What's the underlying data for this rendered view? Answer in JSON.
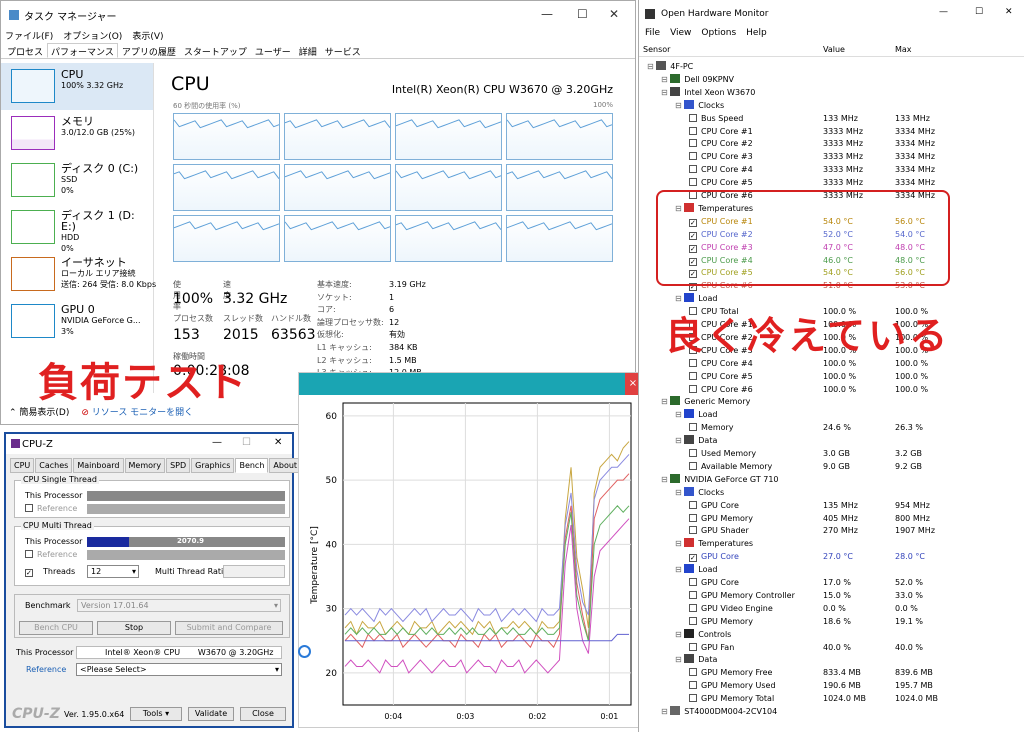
{
  "taskmgr": {
    "title": "タスク マネージャー",
    "menu": [
      "ファイル(F)",
      "オプション(O)",
      "表示(V)"
    ],
    "tabs": [
      "プロセス",
      "パフォーマンス",
      "アプリの履歴",
      "スタートアップ",
      "ユーザー",
      "詳細",
      "サービス"
    ],
    "active_tab": "パフォーマンス",
    "sidebar": [
      {
        "name": "CPU",
        "line1": "100%  3.32 GHz",
        "line2": "",
        "line3": "",
        "color": "#1e88c8"
      },
      {
        "name": "メモリ",
        "line1": "3.0/12.0 GB (25%)",
        "line2": "",
        "line3": "",
        "color": "#9b2dbb"
      },
      {
        "name": "ディスク 0 (C:)",
        "line1": "SSD",
        "line2": "0%",
        "line3": "",
        "color": "#4caf50"
      },
      {
        "name": "ディスク 1 (D: E:)",
        "line1": "HDD",
        "line2": "0%",
        "line3": "",
        "color": "#4caf50"
      },
      {
        "name": "イーサネット",
        "line1": "ローカル エリア接続",
        "line2": "送信: 264 受信: 8.0 Kbps",
        "line3": "",
        "color": "#c86a1e"
      },
      {
        "name": "GPU 0",
        "line1": "NVIDIA GeForce G...",
        "line2": "3%",
        "line3": "",
        "color": "#1e88c8"
      }
    ],
    "header": "CPU",
    "model": "Intel(R) Xeon(R) CPU W3670 @ 3.20GHz",
    "graph_label_left": "60 秒間の使用率 (%)",
    "graph_label_right": "100%",
    "stats": {
      "util_label": "使用率",
      "util": "100%",
      "speed_label": "速度",
      "speed": "3.32 GHz",
      "proc_label": "プロセス数",
      "proc": "153",
      "thr_label": "スレッド数",
      "thr": "2015",
      "handle_label": "ハンドル数",
      "handle": "63563",
      "uptime_label": "稼働時間",
      "uptime": "0:00:28:08"
    },
    "specs": [
      {
        "k": "基本速度:",
        "v": "3.19 GHz"
      },
      {
        "k": "ソケット:",
        "v": "1"
      },
      {
        "k": "コア:",
        "v": "6"
      },
      {
        "k": "論理プロセッサ数:",
        "v": "12"
      },
      {
        "k": "仮想化:",
        "v": "有効"
      },
      {
        "k": "L1 キャッシュ:",
        "v": "384 KB"
      },
      {
        "k": "L2 キャッシュ:",
        "v": "1.5 MB"
      },
      {
        "k": "L3 キャッシュ:",
        "v": "12.0 MB"
      }
    ],
    "footer_simple": "簡易表示(D)",
    "footer_monitor": "リソース モニターを開く"
  },
  "overlay_text": "負荷テスト",
  "note_text": "良く冷えている",
  "cpuz": {
    "title": "CPU-Z",
    "tabs": [
      "CPU",
      "Caches",
      "Mainboard",
      "Memory",
      "SPD",
      "Graphics",
      "Bench",
      "About"
    ],
    "active_tab": "Bench",
    "single_group": "CPU Single Thread",
    "multi_group": "CPU Multi Thread",
    "this_processor": "This Processor",
    "reference": "Reference",
    "multi_score": "2070.9",
    "multi_fraction": 0.21,
    "threads_label": "Threads",
    "threads_value": "12",
    "mt_ratio_label": "Multi Thread Ratio",
    "benchmark_label": "Benchmark",
    "benchmark_value": "Version 17.01.64",
    "bench_cpu_btn": "Bench CPU",
    "stop_btn": "Stop",
    "submit_btn": "Submit and Compare",
    "proc_label": "This Processor",
    "proc_value": "Intel® Xeon® CPU       W3670 @ 3.20GHz",
    "ref_label": "Reference",
    "ref_value": "<Please Select>",
    "brand": "CPU-Z",
    "version": "Ver. 1.95.0.x64",
    "tools_btn": "Tools",
    "validate_btn": "Validate",
    "close_btn": "Close"
  },
  "chart_data": {
    "type": "line",
    "ylabel": "Temperature [°C]",
    "ylim": [
      15,
      62
    ],
    "yticks": [
      20,
      30,
      40,
      50,
      60
    ],
    "xticks": [
      "0:04",
      "0:03",
      "0:02",
      "0:01"
    ],
    "xlim": [
      0,
      1
    ],
    "series": [
      {
        "color": "#c8a640",
        "values": [
          27,
          28,
          26,
          28,
          27,
          27,
          28,
          26,
          27,
          28,
          27,
          26,
          28,
          27,
          27,
          28,
          26,
          27,
          28,
          27,
          28,
          27,
          26,
          28,
          27,
          28,
          26,
          27,
          27,
          28,
          27,
          28,
          27,
          26,
          28,
          27,
          27,
          28,
          44,
          52,
          38,
          33,
          27,
          48,
          52,
          53,
          54,
          53,
          55,
          56
        ]
      },
      {
        "color": "#8a8ae0",
        "values": [
          29,
          30,
          29,
          30,
          29,
          28,
          30,
          29,
          30,
          29,
          28,
          29,
          30,
          29,
          30,
          28,
          29,
          30,
          29,
          29,
          30,
          29,
          28,
          30,
          29,
          29,
          30,
          28,
          29,
          30,
          29,
          30,
          29,
          28,
          30,
          29,
          29,
          30,
          43,
          48,
          36,
          31,
          29,
          47,
          50,
          51,
          52,
          52,
          53,
          54
        ]
      },
      {
        "color": "#e06060",
        "values": [
          25,
          26,
          25,
          24,
          26,
          25,
          26,
          25,
          25,
          26,
          24,
          25,
          26,
          25,
          24,
          25,
          26,
          25,
          25,
          24,
          26,
          25,
          25,
          24,
          26,
          25,
          26,
          24,
          25,
          25,
          26,
          25,
          24,
          26,
          25,
          25,
          24,
          26,
          41,
          46,
          34,
          29,
          25,
          44,
          47,
          48,
          49,
          50,
          50,
          51
        ]
      },
      {
        "color": "#60b060",
        "values": [
          26,
          27,
          26,
          27,
          26,
          27,
          26,
          26,
          27,
          26,
          27,
          26,
          26,
          27,
          26,
          27,
          26,
          26,
          27,
          26,
          27,
          26,
          27,
          26,
          26,
          27,
          26,
          27,
          26,
          27,
          26,
          26,
          27,
          26,
          27,
          26,
          26,
          27,
          40,
          45,
          32,
          28,
          25,
          40,
          43,
          44,
          45,
          46,
          45,
          46
        ]
      },
      {
        "color": "#d050c0",
        "values": [
          21,
          22,
          21,
          21,
          22,
          21,
          20,
          22,
          21,
          21,
          22,
          20,
          21,
          22,
          21,
          20,
          21,
          22,
          21,
          21,
          22,
          20,
          21,
          22,
          21,
          21,
          20,
          22,
          21,
          21,
          22,
          20,
          21,
          22,
          21,
          20,
          21,
          22,
          37,
          43,
          30,
          25,
          23,
          35,
          39,
          40,
          41,
          42,
          43,
          44
        ]
      },
      {
        "color": "#6060d0",
        "values": [
          25,
          25,
          25,
          25,
          25,
          25,
          25,
          25,
          25,
          25,
          25,
          25,
          25,
          25,
          25,
          25,
          25,
          25,
          25,
          25,
          25,
          25,
          25,
          25,
          25,
          25,
          25,
          25,
          25,
          25,
          25,
          25,
          25,
          25,
          25,
          25,
          25,
          25,
          25,
          25,
          25,
          25,
          25,
          25,
          25,
          25,
          25,
          26,
          26,
          26
        ]
      }
    ]
  },
  "ohm": {
    "title": "Open Hardware Monitor",
    "menu": [
      "File",
      "View",
      "Options",
      "Help"
    ],
    "cols": {
      "sensor": "Sensor",
      "value": "Value",
      "max": "Max"
    },
    "rows": [
      {
        "d": 0,
        "t": "4F-PC",
        "icon": "pc"
      },
      {
        "d": 1,
        "t": "Dell 09KPNV",
        "icon": "mb"
      },
      {
        "d": 1,
        "t": "Intel Xeon W3670",
        "icon": "chip"
      },
      {
        "d": 2,
        "t": "Clocks",
        "icon": "clk"
      },
      {
        "d": 3,
        "t": "Bus Speed",
        "v": "133 MHz",
        "m": "133 MHz",
        "c": 0
      },
      {
        "d": 3,
        "t": "CPU Core #1",
        "v": "3333 MHz",
        "m": "3334 MHz",
        "c": 0
      },
      {
        "d": 3,
        "t": "CPU Core #2",
        "v": "3333 MHz",
        "m": "3334 MHz",
        "c": 0
      },
      {
        "d": 3,
        "t": "CPU Core #3",
        "v": "3333 MHz",
        "m": "3334 MHz",
        "c": 0
      },
      {
        "d": 3,
        "t": "CPU Core #4",
        "v": "3333 MHz",
        "m": "3334 MHz",
        "c": 0
      },
      {
        "d": 3,
        "t": "CPU Core #5",
        "v": "3333 MHz",
        "m": "3334 MHz",
        "c": 0
      },
      {
        "d": 3,
        "t": "CPU Core #6",
        "v": "3333 MHz",
        "m": "3334 MHz",
        "c": 0
      },
      {
        "d": 2,
        "t": "Temperatures",
        "icon": "therm"
      },
      {
        "d": 3,
        "t": "CPU Core #1",
        "v": "54.0 °C",
        "m": "56.0 °C",
        "c": 1,
        "col": "#b8860b"
      },
      {
        "d": 3,
        "t": "CPU Core #2",
        "v": "52.0 °C",
        "m": "54.0 °C",
        "c": 1,
        "col": "#5566cc"
      },
      {
        "d": 3,
        "t": "CPU Core #3",
        "v": "47.0 °C",
        "m": "48.0 °C",
        "c": 1,
        "col": "#c040b0"
      },
      {
        "d": 3,
        "t": "CPU Core #4",
        "v": "46.0 °C",
        "m": "48.0 °C",
        "c": 1,
        "col": "#4a9a4a"
      },
      {
        "d": 3,
        "t": "CPU Core #5",
        "v": "54.0 °C",
        "m": "56.0 °C",
        "c": 1,
        "col": "#a0a020"
      },
      {
        "d": 3,
        "t": "CPU Core #6",
        "v": "51.0 °C",
        "m": "53.0 °C",
        "c": 1,
        "col": "#c05040"
      },
      {
        "d": 2,
        "t": "Load",
        "icon": "load"
      },
      {
        "d": 3,
        "t": "CPU Total",
        "v": "100.0 %",
        "m": "100.0 %",
        "c": 0
      },
      {
        "d": 3,
        "t": "CPU Core #1",
        "v": "100.0 %",
        "m": "100.0 %",
        "c": 0
      },
      {
        "d": 3,
        "t": "CPU Core #2",
        "v": "100.0 %",
        "m": "100.0 %",
        "c": 0
      },
      {
        "d": 3,
        "t": "CPU Core #3",
        "v": "100.0 %",
        "m": "100.0 %",
        "c": 0
      },
      {
        "d": 3,
        "t": "CPU Core #4",
        "v": "100.0 %",
        "m": "100.0 %",
        "c": 0
      },
      {
        "d": 3,
        "t": "CPU Core #5",
        "v": "100.0 %",
        "m": "100.0 %",
        "c": 0
      },
      {
        "d": 3,
        "t": "CPU Core #6",
        "v": "100.0 %",
        "m": "100.0 %",
        "c": 0
      },
      {
        "d": 1,
        "t": "Generic Memory",
        "icon": "ram"
      },
      {
        "d": 2,
        "t": "Load",
        "icon": "load"
      },
      {
        "d": 3,
        "t": "Memory",
        "v": "24.6 %",
        "m": "26.3 %",
        "c": 0
      },
      {
        "d": 2,
        "t": "Data",
        "icon": "data"
      },
      {
        "d": 3,
        "t": "Used Memory",
        "v": "3.0 GB",
        "m": "3.2 GB",
        "c": 0
      },
      {
        "d": 3,
        "t": "Available Memory",
        "v": "9.0 GB",
        "m": "9.2 GB",
        "c": 0
      },
      {
        "d": 1,
        "t": "NVIDIA GeForce GT 710",
        "icon": "gpu"
      },
      {
        "d": 2,
        "t": "Clocks",
        "icon": "clk"
      },
      {
        "d": 3,
        "t": "GPU Core",
        "v": "135 MHz",
        "m": "954 MHz",
        "c": 0
      },
      {
        "d": 3,
        "t": "GPU Memory",
        "v": "405 MHz",
        "m": "800 MHz",
        "c": 0
      },
      {
        "d": 3,
        "t": "GPU Shader",
        "v": "270 MHz",
        "m": "1907 MHz",
        "c": 0
      },
      {
        "d": 2,
        "t": "Temperatures",
        "icon": "therm"
      },
      {
        "d": 3,
        "t": "GPU Core",
        "v": "27.0 °C",
        "m": "28.0 °C",
        "c": 1,
        "col": "#3344bb"
      },
      {
        "d": 2,
        "t": "Load",
        "icon": "load"
      },
      {
        "d": 3,
        "t": "GPU Core",
        "v": "17.0 %",
        "m": "52.0 %",
        "c": 0
      },
      {
        "d": 3,
        "t": "GPU Memory Controller",
        "v": "15.0 %",
        "m": "33.0 %",
        "c": 0
      },
      {
        "d": 3,
        "t": "GPU Video Engine",
        "v": "0.0 %",
        "m": "0.0 %",
        "c": 0
      },
      {
        "d": 3,
        "t": "GPU Memory",
        "v": "18.6 %",
        "m": "19.1 %",
        "c": 0
      },
      {
        "d": 2,
        "t": "Controls",
        "icon": "fan"
      },
      {
        "d": 3,
        "t": "GPU Fan",
        "v": "40.0 %",
        "m": "40.0 %",
        "c": 0
      },
      {
        "d": 2,
        "t": "Data",
        "icon": "data"
      },
      {
        "d": 3,
        "t": "GPU Memory Free",
        "v": "833.4 MB",
        "m": "839.6 MB",
        "c": 0
      },
      {
        "d": 3,
        "t": "GPU Memory Used",
        "v": "190.6 MB",
        "m": "195.7 MB",
        "c": 0
      },
      {
        "d": 3,
        "t": "GPU Memory Total",
        "v": "1024.0 MB",
        "m": "1024.0 MB",
        "c": 0
      },
      {
        "d": 1,
        "t": "ST4000DM004-2CV104",
        "icon": "hdd"
      }
    ]
  }
}
